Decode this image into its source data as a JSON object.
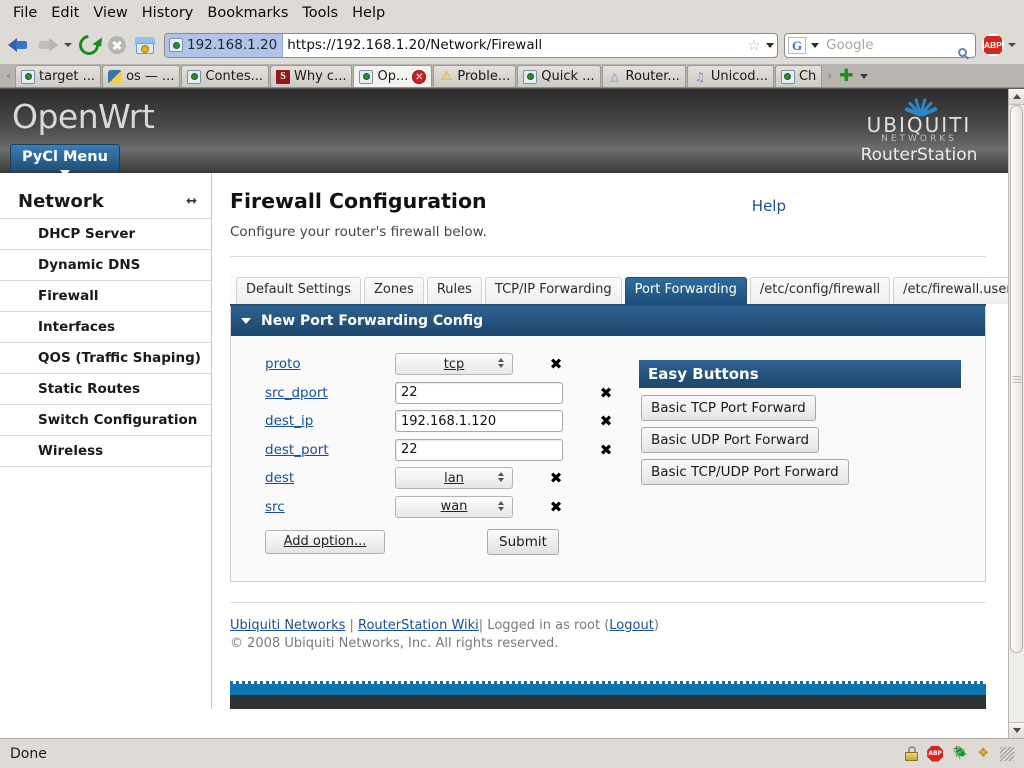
{
  "browser": {
    "menus": [
      "File",
      "Edit",
      "View",
      "History",
      "Bookmarks",
      "Tools",
      "Help"
    ],
    "toolbar": {
      "back_icon": "back-arrow-icon",
      "forward_icon": "forward-arrow-icon",
      "history_dropdown_icon": "chevron-down-icon",
      "reload_icon": "reload-icon",
      "stop_icon": "stop-icon",
      "home_icon": "home-icon",
      "abp_icon": "adblock-plus-icon",
      "abp_label": "ABP",
      "abp_caret_icon": "chevron-down-icon"
    },
    "url_bar": {
      "identity_label": "192.168.1.20",
      "identity_icon": "site-identity-globe-icon",
      "url": "https://192.168.1.20/Network/Firewall",
      "star_icon": "bookmark-star-icon",
      "caret_icon": "chevron-down-icon"
    },
    "search_bar": {
      "engine_label": "G",
      "engine_caret_icon": "chevron-down-icon",
      "placeholder": "Google",
      "value": "",
      "search_icon": "magnifier-icon"
    },
    "tabs": [
      {
        "label": "target ...",
        "favicon": "globe-icon",
        "active": false
      },
      {
        "label": "os — ...",
        "favicon": "python-icon",
        "active": false
      },
      {
        "label": "Contes...",
        "favicon": "globe-icon",
        "active": false
      },
      {
        "label": "Why c...",
        "favicon": "stackoverflow-icon",
        "active": false
      },
      {
        "label": "Op...",
        "favicon": "globe-icon",
        "active": true
      },
      {
        "label": "Proble...",
        "favicon": "warning-icon",
        "active": false
      },
      {
        "label": "Quick ...",
        "favicon": "globe-icon",
        "active": false
      },
      {
        "label": "Router...",
        "favicon": "wiki-icon",
        "active": false
      },
      {
        "label": "Unicod...",
        "favicon": "unicode-icon",
        "active": false
      },
      {
        "label": "Ch",
        "favicon": "globe-icon",
        "active": false
      }
    ],
    "tab_scroll_left_icon": "chevron-left-icon",
    "tab_scroll_right_icon": "chevron-right-icon",
    "new_tab_icon": "plus-icon",
    "tab_list_icon": "chevron-down-icon",
    "close_tab_icon": "close-icon",
    "status": {
      "text": "Done",
      "icons": [
        "lock-icon",
        "adblock-plus-icon",
        "firebug-icon",
        "noscript-icon",
        "resize-grip-icon"
      ]
    },
    "scrollbar": {
      "up_icon": "scroll-up-arrow-icon",
      "down_icon": "scroll-down-arrow-icon"
    }
  },
  "page": {
    "brand": "OpenWrt",
    "menu_button": "PyCl Menu",
    "vendor": {
      "name": "UBIQUITI",
      "sub": "NETWORKS",
      "product": "RouterStation"
    },
    "sidebar": {
      "title": "Network",
      "collapse_icon": "collapse-arrows-icon",
      "items": [
        {
          "label": "DHCP Server"
        },
        {
          "label": "Dynamic DNS"
        },
        {
          "label": "Firewall"
        },
        {
          "label": "Interfaces"
        },
        {
          "label": "QOS (Traffic Shaping)"
        },
        {
          "label": "Static Routes"
        },
        {
          "label": "Switch Configuration"
        },
        {
          "label": "Wireless"
        }
      ]
    },
    "title": "Firewall Configuration",
    "subtitle": "Configure your router's firewall below.",
    "help_label": "Help",
    "tabs": [
      {
        "label": "Default Settings",
        "active": false
      },
      {
        "label": "Zones",
        "active": false
      },
      {
        "label": "Rules",
        "active": false
      },
      {
        "label": "TCP/IP Forwarding",
        "active": false
      },
      {
        "label": "Port Forwarding",
        "active": true
      },
      {
        "label": "/etc/config/firewall",
        "active": false
      },
      {
        "label": "/etc/firewall.user",
        "active": false
      }
    ],
    "panel": {
      "title": "New Port Forwarding Config",
      "toggle_icon": "triangle-down-icon",
      "rows": [
        {
          "label": "proto",
          "type": "select",
          "value": "tcp",
          "remove_icon": "remove-x-icon"
        },
        {
          "label": "src_dport",
          "type": "input",
          "value": "22",
          "remove_icon": "remove-x-icon"
        },
        {
          "label": "dest_ip",
          "type": "input",
          "value": "192.168.1.120",
          "remove_icon": "remove-x-icon"
        },
        {
          "label": "dest_port",
          "type": "input",
          "value": "22",
          "remove_icon": "remove-x-icon"
        },
        {
          "label": "dest",
          "type": "select",
          "value": "lan",
          "remove_icon": "remove-x-icon"
        },
        {
          "label": "src",
          "type": "select",
          "value": "wan",
          "remove_icon": "remove-x-icon"
        }
      ],
      "add_option_label": "Add option...",
      "submit_label": "Submit"
    },
    "easy_buttons": {
      "title": "Easy Buttons",
      "buttons": [
        "Basic TCP Port Forward",
        "Basic UDP Port Forward",
        "Basic TCP/UDP Port Forward"
      ]
    },
    "footer": {
      "link1": "Ubiquiti Networks",
      "sep": " | ",
      "link2": "RouterStation Wiki",
      "logged_in": "| Logged in as root (",
      "logout": "Logout",
      "close_paren": ")",
      "copyright": "© 2008 Ubiquiti Networks, Inc. All rights reserved."
    }
  }
}
